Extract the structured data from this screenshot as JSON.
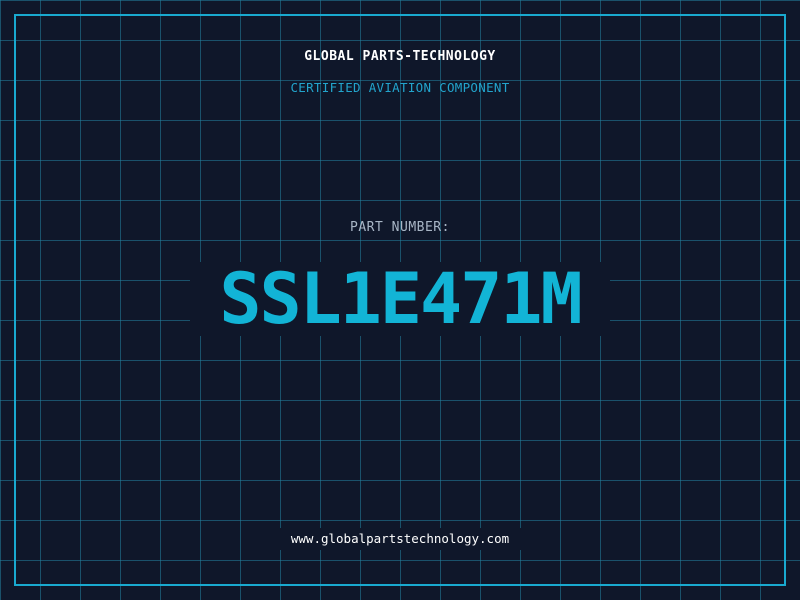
{
  "header": {
    "company": "GLOBAL PARTS-TECHNOLOGY",
    "tagline": "CERTIFIED AVIATION COMPONENT"
  },
  "part": {
    "label": "PART NUMBER:",
    "number": "SSL1E471M"
  },
  "footer": {
    "website": "www.globalpartstechnology.com"
  },
  "colors": {
    "background": "#0f172a",
    "grid": "#2282a0",
    "frame": "#19a9cf",
    "accent": "#12b4d6",
    "tagline": "#22a4cc",
    "label": "#a9b6c6",
    "text": "#ffffff"
  }
}
